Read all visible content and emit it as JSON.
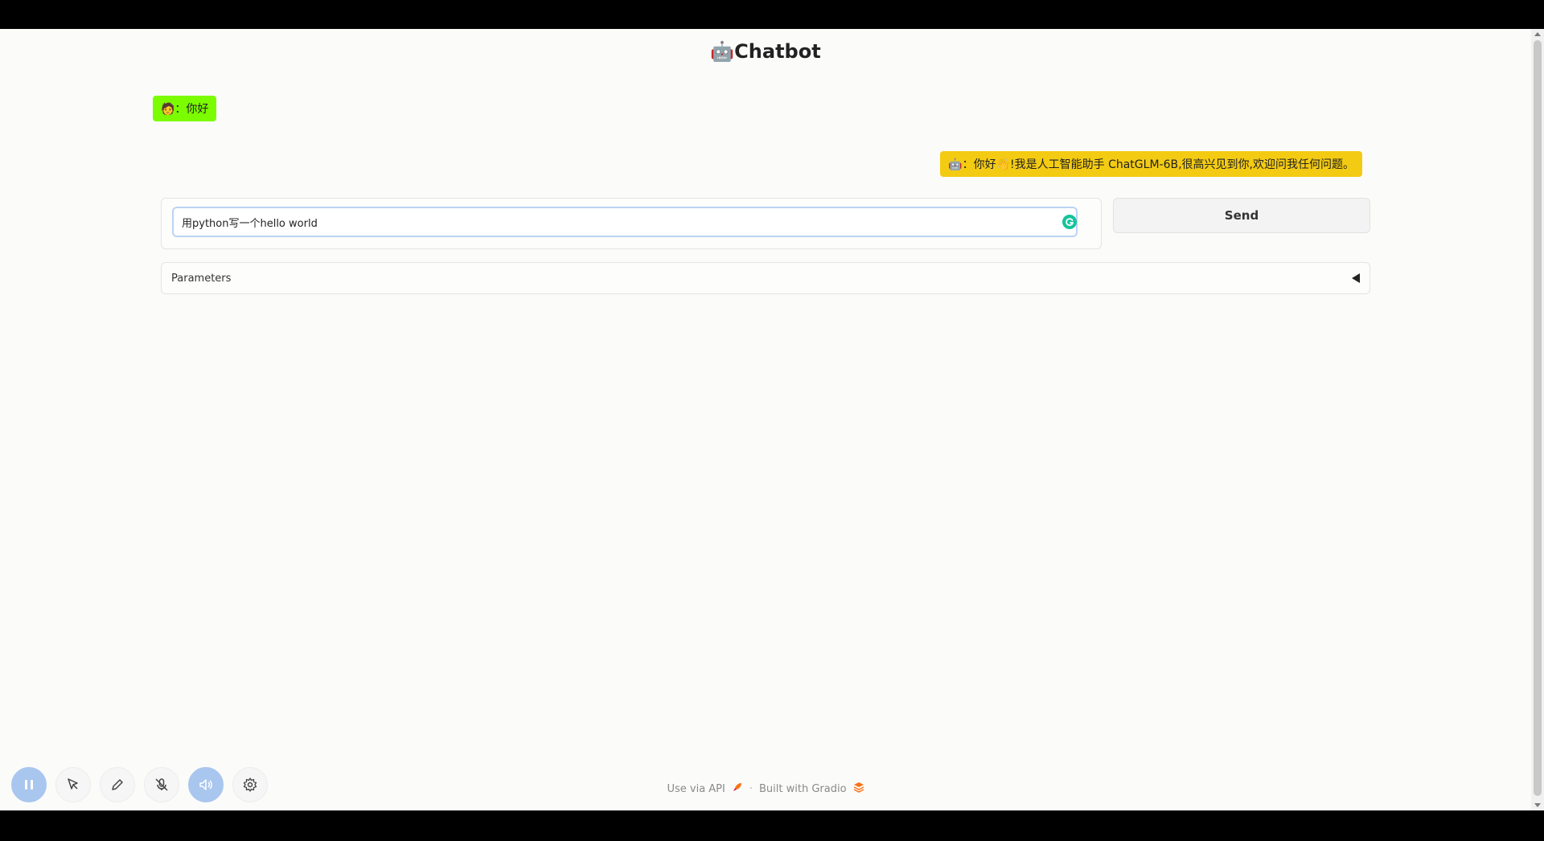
{
  "app": {
    "title": "🤖Chatbot"
  },
  "chat": {
    "user_message": "🧑：你好",
    "bot_message": "🤖：你好👋!我是人工智能助手 ChatGLM-6B,很高兴见到你,欢迎问我任何问题。"
  },
  "input": {
    "value": "用python写一个hello world"
  },
  "send_button": {
    "label": "Send"
  },
  "parameters": {
    "label": "Parameters"
  },
  "footer": {
    "api_link": "Use via API",
    "built_with": "Built with Gradio"
  },
  "toolbar": {
    "items": [
      "pause-icon",
      "cursor-icon",
      "pen-icon",
      "mic-off-icon",
      "speaker-icon",
      "gear-icon"
    ]
  },
  "colors": {
    "user_bubble": "#7cfc00",
    "bot_bubble": "#f4cb13",
    "toolbar_active": "#a9c6ee"
  }
}
